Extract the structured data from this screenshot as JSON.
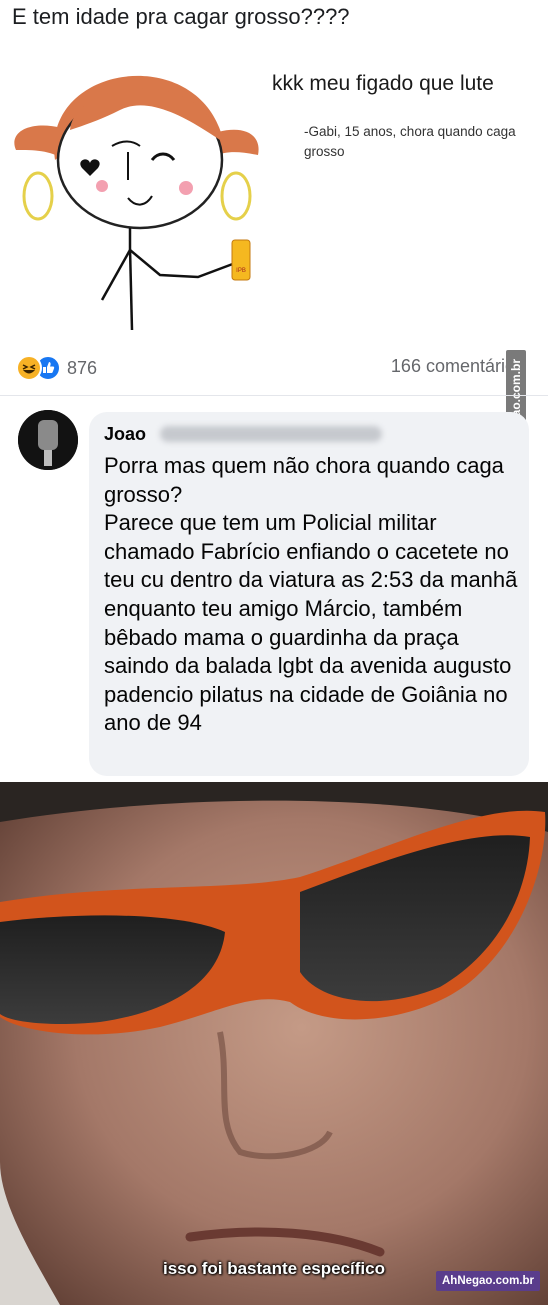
{
  "post": {
    "caption": "E tem idade pra cagar grosso????"
  },
  "meme": {
    "line1": "kkk meu figado que lute",
    "attribution": "-Gabi, 15 anos, chora quando caga grosso",
    "sign_text": "IPB"
  },
  "reactions": {
    "count": "876",
    "icons": [
      "haha-icon",
      "like-icon"
    ],
    "comments": "166 comentários"
  },
  "comment": {
    "author": "Joao",
    "text": "Porra mas quem não chora quando caga grosso?\nParece que tem um Policial militar chamado Fabrício enfiando o cacetete no teu cu dentro da viatura as 2:53 da manhã enquanto teu amigo  Márcio, também bêbado mama o guardinha da praça saindo da balada lgbt da avenida augusto padencio pilatus na cidade de Goiânia no ano de 94"
  },
  "photo": {
    "subtitle": "isso foi bastante específico"
  },
  "watermarks": {
    "side": "AhNegao.com.br",
    "bottom": "AhNegao.com.br"
  },
  "colors": {
    "link_blue": "#1877f2",
    "haha_yellow": "#f7b125",
    "glasses_frame": "#d2541c",
    "hair": "#d9784a"
  }
}
